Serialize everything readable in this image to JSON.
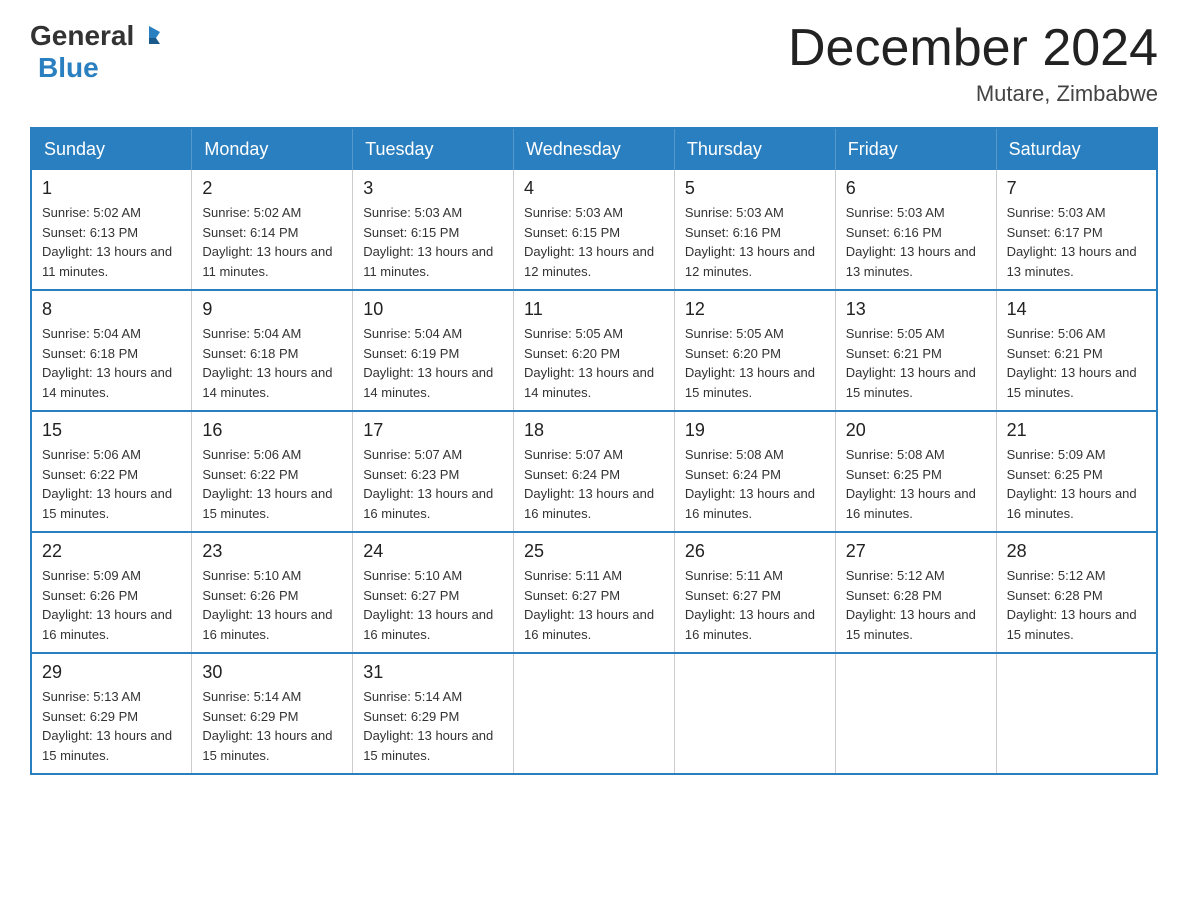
{
  "header": {
    "logo": {
      "general": "General",
      "blue": "Blue"
    },
    "title": "December 2024",
    "subtitle": "Mutare, Zimbabwe"
  },
  "days_of_week": [
    "Sunday",
    "Monday",
    "Tuesday",
    "Wednesday",
    "Thursday",
    "Friday",
    "Saturday"
  ],
  "weeks": [
    [
      {
        "day": "1",
        "sunrise": "5:02 AM",
        "sunset": "6:13 PM",
        "daylight": "13 hours and 11 minutes."
      },
      {
        "day": "2",
        "sunrise": "5:02 AM",
        "sunset": "6:14 PM",
        "daylight": "13 hours and 11 minutes."
      },
      {
        "day": "3",
        "sunrise": "5:03 AM",
        "sunset": "6:15 PM",
        "daylight": "13 hours and 11 minutes."
      },
      {
        "day": "4",
        "sunrise": "5:03 AM",
        "sunset": "6:15 PM",
        "daylight": "13 hours and 12 minutes."
      },
      {
        "day": "5",
        "sunrise": "5:03 AM",
        "sunset": "6:16 PM",
        "daylight": "13 hours and 12 minutes."
      },
      {
        "day": "6",
        "sunrise": "5:03 AM",
        "sunset": "6:16 PM",
        "daylight": "13 hours and 13 minutes."
      },
      {
        "day": "7",
        "sunrise": "5:03 AM",
        "sunset": "6:17 PM",
        "daylight": "13 hours and 13 minutes."
      }
    ],
    [
      {
        "day": "8",
        "sunrise": "5:04 AM",
        "sunset": "6:18 PM",
        "daylight": "13 hours and 14 minutes."
      },
      {
        "day": "9",
        "sunrise": "5:04 AM",
        "sunset": "6:18 PM",
        "daylight": "13 hours and 14 minutes."
      },
      {
        "day": "10",
        "sunrise": "5:04 AM",
        "sunset": "6:19 PM",
        "daylight": "13 hours and 14 minutes."
      },
      {
        "day": "11",
        "sunrise": "5:05 AM",
        "sunset": "6:20 PM",
        "daylight": "13 hours and 14 minutes."
      },
      {
        "day": "12",
        "sunrise": "5:05 AM",
        "sunset": "6:20 PM",
        "daylight": "13 hours and 15 minutes."
      },
      {
        "day": "13",
        "sunrise": "5:05 AM",
        "sunset": "6:21 PM",
        "daylight": "13 hours and 15 minutes."
      },
      {
        "day": "14",
        "sunrise": "5:06 AM",
        "sunset": "6:21 PM",
        "daylight": "13 hours and 15 minutes."
      }
    ],
    [
      {
        "day": "15",
        "sunrise": "5:06 AM",
        "sunset": "6:22 PM",
        "daylight": "13 hours and 15 minutes."
      },
      {
        "day": "16",
        "sunrise": "5:06 AM",
        "sunset": "6:22 PM",
        "daylight": "13 hours and 15 minutes."
      },
      {
        "day": "17",
        "sunrise": "5:07 AM",
        "sunset": "6:23 PM",
        "daylight": "13 hours and 16 minutes."
      },
      {
        "day": "18",
        "sunrise": "5:07 AM",
        "sunset": "6:24 PM",
        "daylight": "13 hours and 16 minutes."
      },
      {
        "day": "19",
        "sunrise": "5:08 AM",
        "sunset": "6:24 PM",
        "daylight": "13 hours and 16 minutes."
      },
      {
        "day": "20",
        "sunrise": "5:08 AM",
        "sunset": "6:25 PM",
        "daylight": "13 hours and 16 minutes."
      },
      {
        "day": "21",
        "sunrise": "5:09 AM",
        "sunset": "6:25 PM",
        "daylight": "13 hours and 16 minutes."
      }
    ],
    [
      {
        "day": "22",
        "sunrise": "5:09 AM",
        "sunset": "6:26 PM",
        "daylight": "13 hours and 16 minutes."
      },
      {
        "day": "23",
        "sunrise": "5:10 AM",
        "sunset": "6:26 PM",
        "daylight": "13 hours and 16 minutes."
      },
      {
        "day": "24",
        "sunrise": "5:10 AM",
        "sunset": "6:27 PM",
        "daylight": "13 hours and 16 minutes."
      },
      {
        "day": "25",
        "sunrise": "5:11 AM",
        "sunset": "6:27 PM",
        "daylight": "13 hours and 16 minutes."
      },
      {
        "day": "26",
        "sunrise": "5:11 AM",
        "sunset": "6:27 PM",
        "daylight": "13 hours and 16 minutes."
      },
      {
        "day": "27",
        "sunrise": "5:12 AM",
        "sunset": "6:28 PM",
        "daylight": "13 hours and 15 minutes."
      },
      {
        "day": "28",
        "sunrise": "5:12 AM",
        "sunset": "6:28 PM",
        "daylight": "13 hours and 15 minutes."
      }
    ],
    [
      {
        "day": "29",
        "sunrise": "5:13 AM",
        "sunset": "6:29 PM",
        "daylight": "13 hours and 15 minutes."
      },
      {
        "day": "30",
        "sunrise": "5:14 AM",
        "sunset": "6:29 PM",
        "daylight": "13 hours and 15 minutes."
      },
      {
        "day": "31",
        "sunrise": "5:14 AM",
        "sunset": "6:29 PM",
        "daylight": "13 hours and 15 minutes."
      },
      null,
      null,
      null,
      null
    ]
  ]
}
